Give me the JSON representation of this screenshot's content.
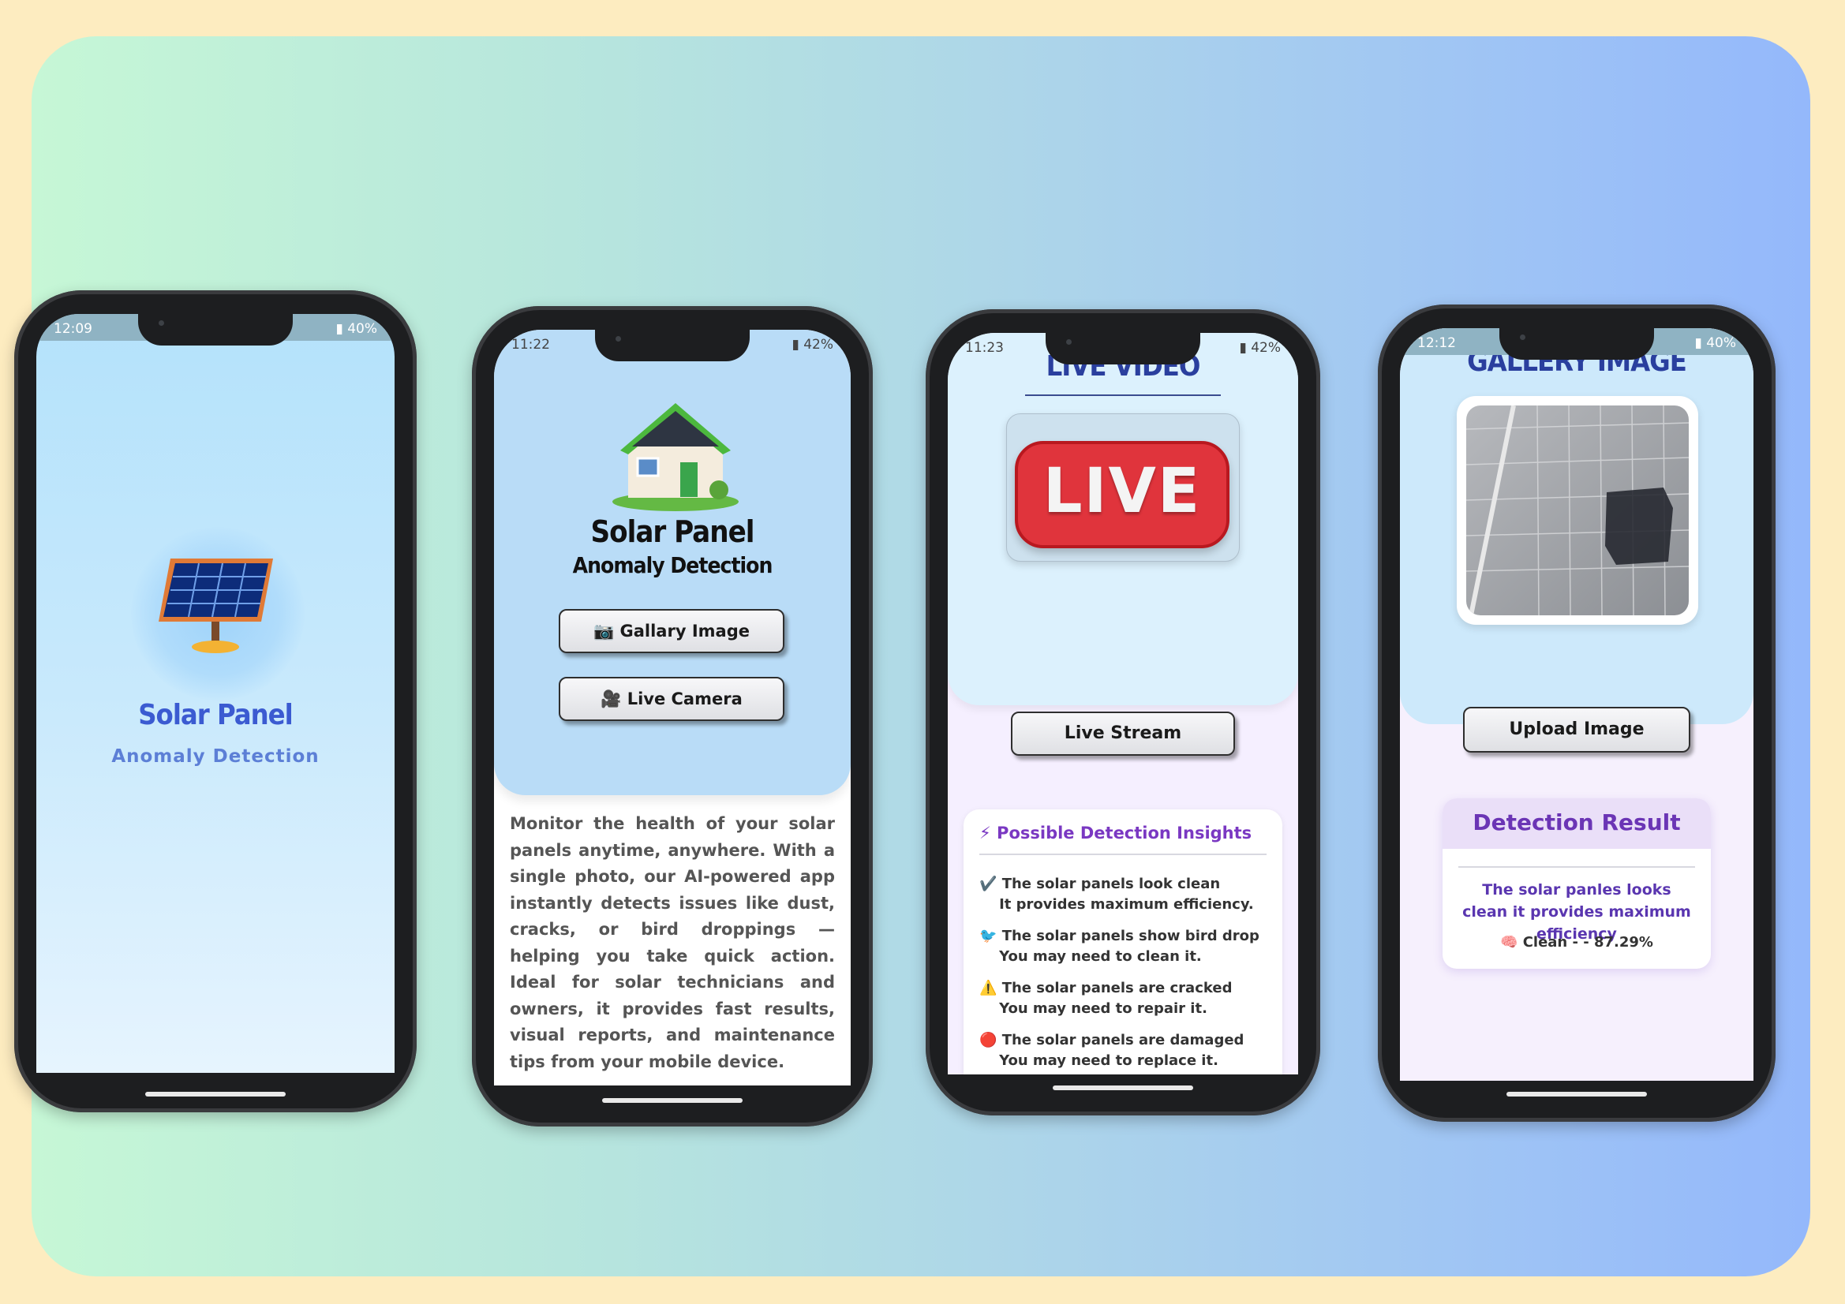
{
  "phone1": {
    "status": {
      "time": "12:09",
      "battery": "40%"
    },
    "title": "Solar Panel",
    "subtitle": "Anomaly Detection",
    "icon": "solar-panel-icon"
  },
  "phone2": {
    "status": {
      "time": "11:22",
      "battery": "42%"
    },
    "title": "Solar Panel",
    "subtitle": "Anomaly Detection",
    "gallery_button": "📷 Gallary Image",
    "camera_button": "🎥 Live Camera",
    "description": "Monitor the health of your solar panels anytime, anywhere. With a single photo, our AI-powered app instantly detects issues like dust, cracks, or bird droppings — helping you take quick action. Ideal for solar technicians and owners, it provides fast results, visual reports, and maintenance tips from your mobile device."
  },
  "phone3": {
    "status": {
      "time": "11:23",
      "battery": "42%"
    },
    "header": "LIVE VIDEO",
    "live_badge": "LIVE",
    "stream_button": "Live Stream",
    "insights_title": "⚡ Possible Detection Insights",
    "insights": [
      {
        "icon": "✔️",
        "line1": "The solar panels look clean",
        "line2": "It provides maximum efficiency."
      },
      {
        "icon": "🐦",
        "line1": "The solar panels show bird drop",
        "line2": "You may need to clean it."
      },
      {
        "icon": "⚠️",
        "line1": "The solar panels are cracked",
        "line2": "You may need to repair it."
      },
      {
        "icon": "🔴",
        "line1": "The solar panels are damaged",
        "line2": "You may need to replace it."
      }
    ]
  },
  "phone4": {
    "status": {
      "time": "12:12",
      "battery": "40%"
    },
    "header": "GALLERY IMAGE",
    "upload_button": "Upload Image",
    "result_title": "Detection Result",
    "result_text": "The solar panles looks clean it provides maximum efficiency",
    "result_label": "🧠 Clean - - 87.29%"
  }
}
